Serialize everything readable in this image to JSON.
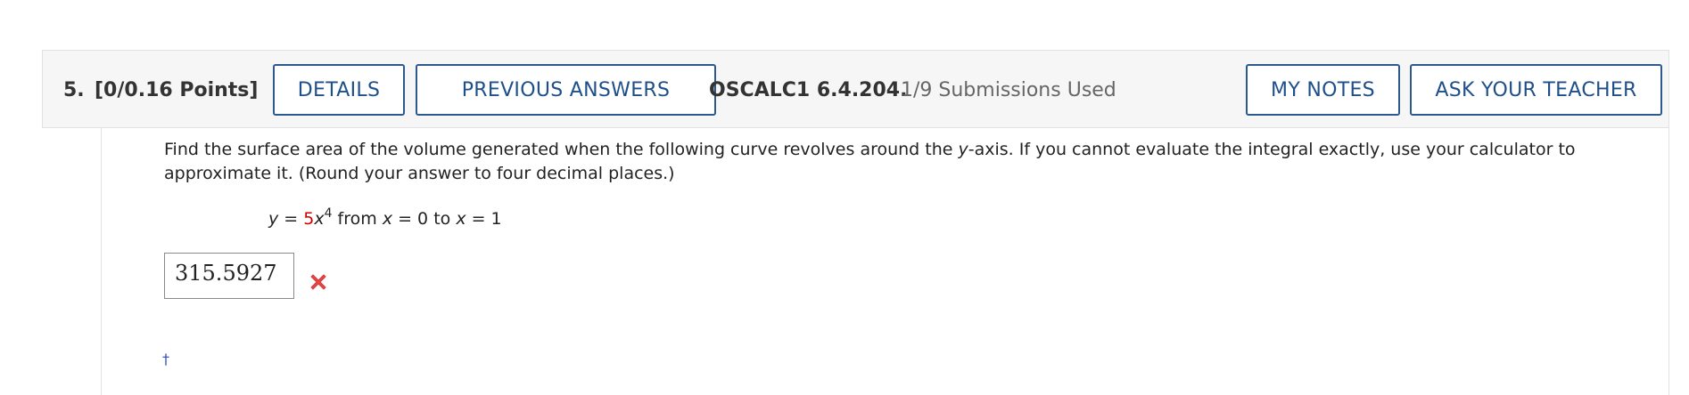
{
  "question": {
    "number": "5.",
    "points": "[0/0.16 Points]",
    "buttons": {
      "details": "DETAILS",
      "previous_answers": "PREVIOUS ANSWERS",
      "my_notes": "MY NOTES",
      "ask_teacher": "ASK YOUR TEACHER"
    },
    "code": "OSCALC1 6.4.204.",
    "submissions": "1/9 Submissions Used"
  },
  "problem": {
    "prompt_part1": "Find the surface area of the volume generated when the following curve revolves around the ",
    "prompt_var": "y",
    "prompt_part2": "-axis. If you cannot evaluate the integral exactly, use your calculator to approximate it. (Round your answer to four decimal places.)",
    "equation": {
      "lhs_var": "y",
      "equals": " = ",
      "coefficient": "5",
      "var": "x",
      "exponent": "4",
      "from_text": " from ",
      "from_var": "x",
      "from_value": " = 0 to ",
      "to_var": "x",
      "to_value": " = 1"
    }
  },
  "answer": {
    "value": "315.5927",
    "status_icon": "wrong-x-icon",
    "status_color": "#e04848"
  },
  "footnote_marker": "†",
  "colors": {
    "button_border": "#2c5a8f",
    "button_text": "#1f4f8a",
    "header_bg": "#f6f6f6",
    "coefficient": "#d10000"
  }
}
